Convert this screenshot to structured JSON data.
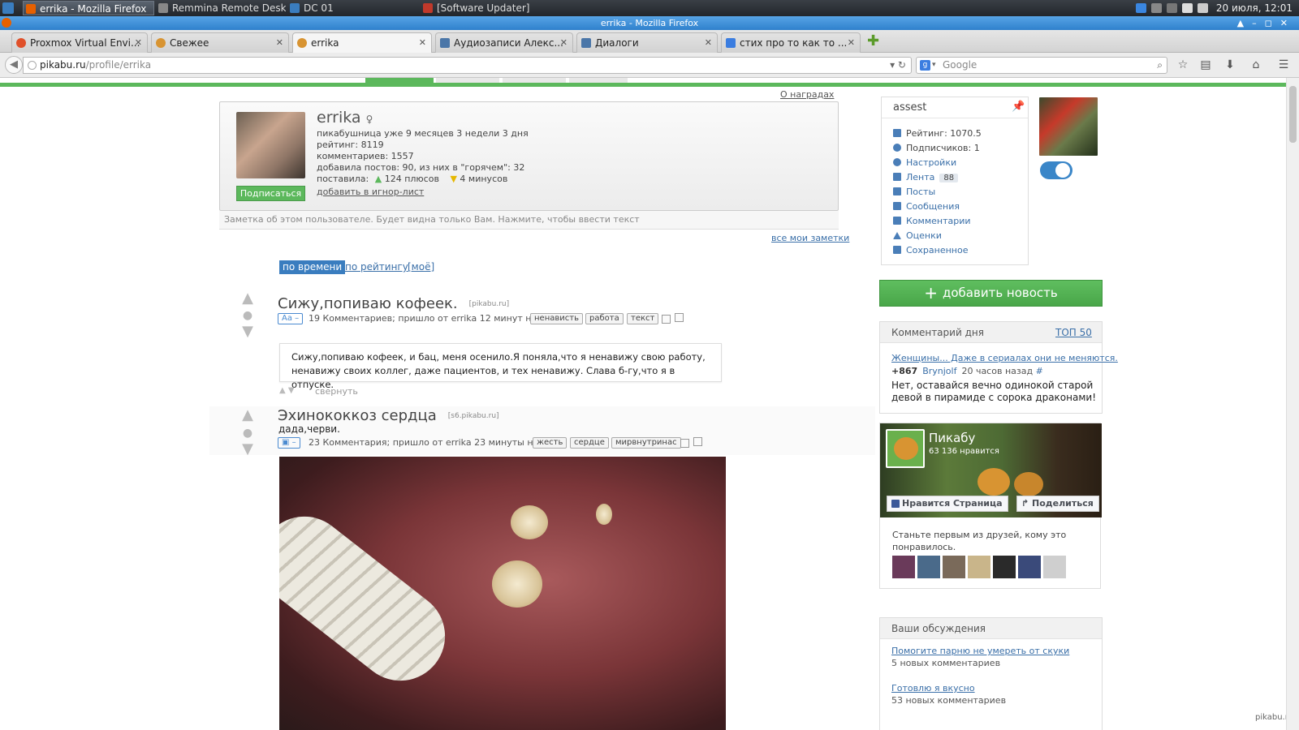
{
  "taskbar": {
    "items": [
      {
        "label": "errika - Mozilla Firefox",
        "color": "#e66000"
      },
      {
        "label": "Remmina Remote Desk...",
        "color": "#888888"
      },
      {
        "label": "DC 01",
        "color": "#3a7dbf"
      },
      {
        "label": "[Software Updater]",
        "color": "#c0392b"
      }
    ],
    "clock": "20 июля, 12:01"
  },
  "window": {
    "title": "errika - Mozilla Firefox"
  },
  "tabs": [
    {
      "label": "Proxmox Virtual Envi...",
      "color": "#e0502a"
    },
    {
      "label": "Свежее",
      "color": "#d89432"
    },
    {
      "label": "errika",
      "color": "#d89432"
    },
    {
      "label": "Аудиозаписи Алекс...",
      "color": "#4a76a8"
    },
    {
      "label": "Диалоги",
      "color": "#4a76a8"
    },
    {
      "label": "стих про то как то ...",
      "color": "#3b7de0"
    }
  ],
  "nav": {
    "url_host": "pikabu.ru",
    "url_path": "/profile/errika",
    "search_placeholder": "Google"
  },
  "profile": {
    "awards_link": "О наградах",
    "name": "errika",
    "lines": [
      "пикабушница уже 9 месяцев 3 недели 3 дня",
      "рейтинг: 8119",
      "комментариев: 1557",
      "добавила постов: 90, из них в \"горячем\": 32"
    ],
    "votes_label": "поставила:",
    "pluses": "124 плюсов",
    "minuses": "4 минусов",
    "subscribe": "Подписаться",
    "ignore": "добавить в игнор-лист",
    "note_placeholder": "Заметка об этом пользователе. Будет видна только Вам. Нажмите, чтобы ввести текст",
    "all_notes": "все мои заметки"
  },
  "sort": {
    "time": "по времени",
    "rating": "по рейтингу",
    "mine": "[моё]"
  },
  "posts": [
    {
      "title": "Сижу,попиваю кофеек.",
      "source": "[pikabu.ru]",
      "type_badge": "Aa –",
      "comments": "19 Комментариев",
      "came_from": "; пришло от",
      "author": "errika",
      "time": "12 минут назад",
      "tags": [
        "ненависть",
        "работа",
        "текст"
      ],
      "body": "Сижу,попиваю кофеек, и бац, меня осенило.Я поняла,что я ненавижу свою работу, ненавижу своих коллег, даже пациентов, и тех ненавижу. Слава б-гу,что я в отпуске.",
      "collapse": "свернуть"
    },
    {
      "title": "Эхинококкоз сердца",
      "source": "[s6.pikabu.ru]",
      "subtitle": "дада,черви.",
      "type_badge": "▣ –",
      "comments": "23 Комментария",
      "came_from": "; пришло от",
      "author": "errika",
      "time": "23 минуты назад",
      "tags": [
        "жесть",
        "сердце",
        "мирвнутринас"
      ]
    }
  ],
  "user_panel": {
    "name": "assest",
    "rating": "Рейтинг: 1070.5",
    "subscribers": "Подписчиков: 1",
    "settings": "Настройки",
    "feed": "Лента",
    "feed_count": "88",
    "posts": "Посты",
    "messages": "Сообщения",
    "comments": "Комментарии",
    "ratings": "Оценки",
    "saved": "Сохраненное"
  },
  "add_news": "добавить новость",
  "comment_of_day": {
    "title": "Комментарий дня",
    "top": "ТОП 50",
    "link": "Женщины... Даже в сериалах они не меняются.",
    "score": "+867",
    "author": "Brynjolf",
    "time": "20 часов назад",
    "hash": "#",
    "text": "Нет, оставайся вечно одинокой старой девой в пирамиде с сорока драконами!"
  },
  "facebook": {
    "name": "Пикабу",
    "likes": "63 136 нравится",
    "like_btn": "Нравится Страница",
    "share_btn": "Поделиться",
    "friends_text": "Станьте первым из друзей, кому это понравилось."
  },
  "discussions": {
    "title": "Ваши обсуждения",
    "items": [
      {
        "link": "Помогите парню не умереть от скуки",
        "sub": "5 новых комментариев"
      },
      {
        "link": "Готовлю я вкусно",
        "sub": "53 новых комментариев"
      }
    ]
  },
  "watermark": "pikabu.ru"
}
